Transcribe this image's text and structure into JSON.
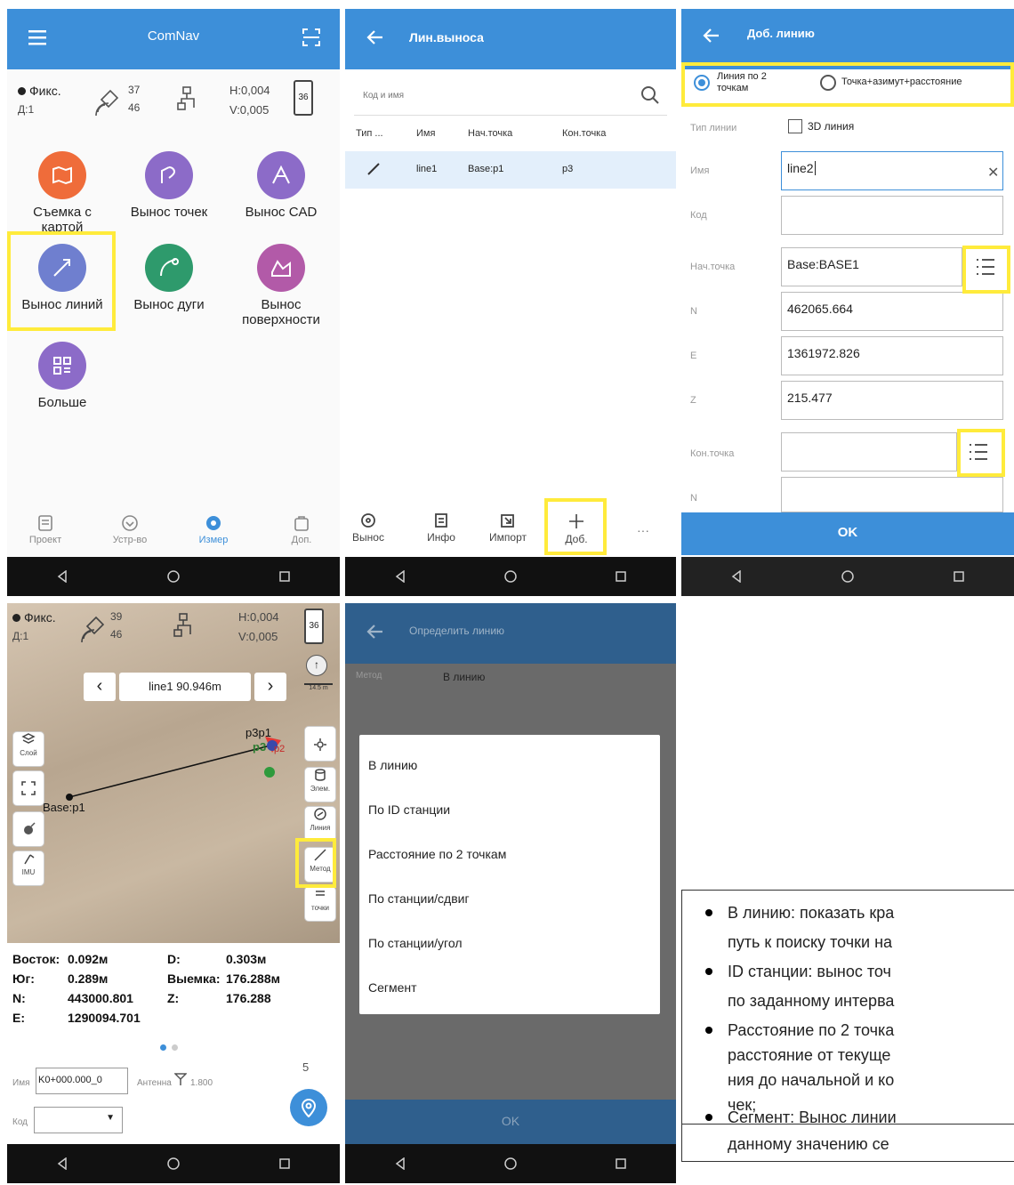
{
  "p1": {
    "app_title": "ComNav",
    "status": {
      "fix": "Фикс.",
      "diff": "Д:1",
      "sats_a": "37",
      "sats_b": "46",
      "h": "H:0,004",
      "v": "V:0,005",
      "battery": "36"
    },
    "apps": [
      {
        "label1": "Съемка с",
        "label2": "картой",
        "icon": "map-icon",
        "color": "#ef6c3a"
      },
      {
        "label1": "Вынос точек",
        "label2": "",
        "icon": "stake-point-icon",
        "color": "#8c6bc8"
      },
      {
        "label1": "Вынос CAD",
        "label2": "",
        "icon": "cad-icon",
        "color": "#8c6bc8"
      },
      {
        "label1": "Вынос линий",
        "label2": "",
        "icon": "stake-line-icon",
        "color": "#6f7fcf"
      },
      {
        "label1": "Вынос дуги",
        "label2": "",
        "icon": "arc-icon",
        "color": "#2e9a6c"
      },
      {
        "label1": "Вынос",
        "label2": "поверхности",
        "icon": "surface-icon",
        "color": "#b25aa8"
      },
      {
        "label1": "Больше",
        "label2": "",
        "icon": "more-icon",
        "color": "#8c6bc8"
      }
    ],
    "tabs": [
      "Проект",
      "Устр-во",
      "Измер",
      "Доп."
    ]
  },
  "p2": {
    "title": "Лин.выноса",
    "search_placeholder": "Код и имя",
    "headers": [
      "Тип ...",
      "Имя",
      "Нач.точка",
      "Кон.точка"
    ],
    "rows": [
      {
        "name": "line1",
        "start": "Base:p1",
        "end": "p3"
      }
    ],
    "toolbar": [
      "Вынос",
      "Инфо",
      "Импорт",
      "Доб."
    ]
  },
  "p3": {
    "title": "Доб. линию",
    "radio1_a": "Линия по 2",
    "radio1_b": "точкам",
    "radio2": "Точка+азимут+расстояние",
    "labels": [
      "Тип линии",
      "Имя",
      "Код",
      "Нач.точка",
      "N",
      "E",
      "Z",
      "Кон.точка",
      "N"
    ],
    "checkbox_3d": "3D линия",
    "name_value": "line2",
    "code_value": "",
    "start_value": "Base:BASE1",
    "n_value": "462065.664",
    "e_value": "1361972.826",
    "z_value": "215.477",
    "end_value": "",
    "ok": "OK"
  },
  "p4": {
    "status": {
      "fix": "Фикс.",
      "diff": "Д:1",
      "sats_a": "39",
      "sats_b": "46",
      "h": "H:0,004",
      "v": "V:0,005",
      "battery": "36"
    },
    "line_selector": "line1 90.946m",
    "scale": "14.5 m",
    "map_labels": {
      "p3p1": "p3p1",
      "p3": "p3",
      "p2": "p2",
      "base": "Base:p1"
    },
    "left_buttons": [
      "Слой",
      "",
      "",
      "IMU"
    ],
    "right_buttons": [
      "",
      "Элем.",
      "Линия",
      "Метод",
      "точки"
    ],
    "readout": [
      {
        "k": "Восток:",
        "v": "0.092м",
        "k2": "D:",
        "v2": "0.303м"
      },
      {
        "k": "Юг:",
        "v": "0.289м",
        "k2": "Выемка:",
        "v2": "176.288м"
      },
      {
        "k": "N:",
        "v": "443000.801",
        "k2": "Z:",
        "v2": "176.288"
      },
      {
        "k": "E:",
        "v": "1290094.701",
        "k2": "",
        "v2": ""
      }
    ],
    "name_label": "Имя",
    "name_value": "K0+000.000_0",
    "antenna_label": "Антенна",
    "antenna_value": "1.800",
    "code_label": "Код",
    "count": "5"
  },
  "p5": {
    "title": "Определить линию",
    "method_label": "Метод",
    "method_value": "В линию",
    "options": [
      "В линию",
      "По ID станции",
      "Расстояние по 2 точкам",
      "По станции/сдвиг",
      "По станции/угол",
      "Сегмент"
    ],
    "ok": "OK"
  },
  "notes": [
    {
      "l1": "В линию: показать кра",
      "l2": "путь к поиску точки на"
    },
    {
      "l1": "ID станции: вынос точ",
      "l2": "по заданному интерва"
    },
    {
      "l1": "Расстояние по 2 точка",
      "l2": "расстояние от текуще",
      "l3": "ния до начальной и ко",
      "l4": "чек;"
    },
    {
      "l1": "Сегмент: Вынос линии",
      "l2": "данному значению се"
    }
  ]
}
